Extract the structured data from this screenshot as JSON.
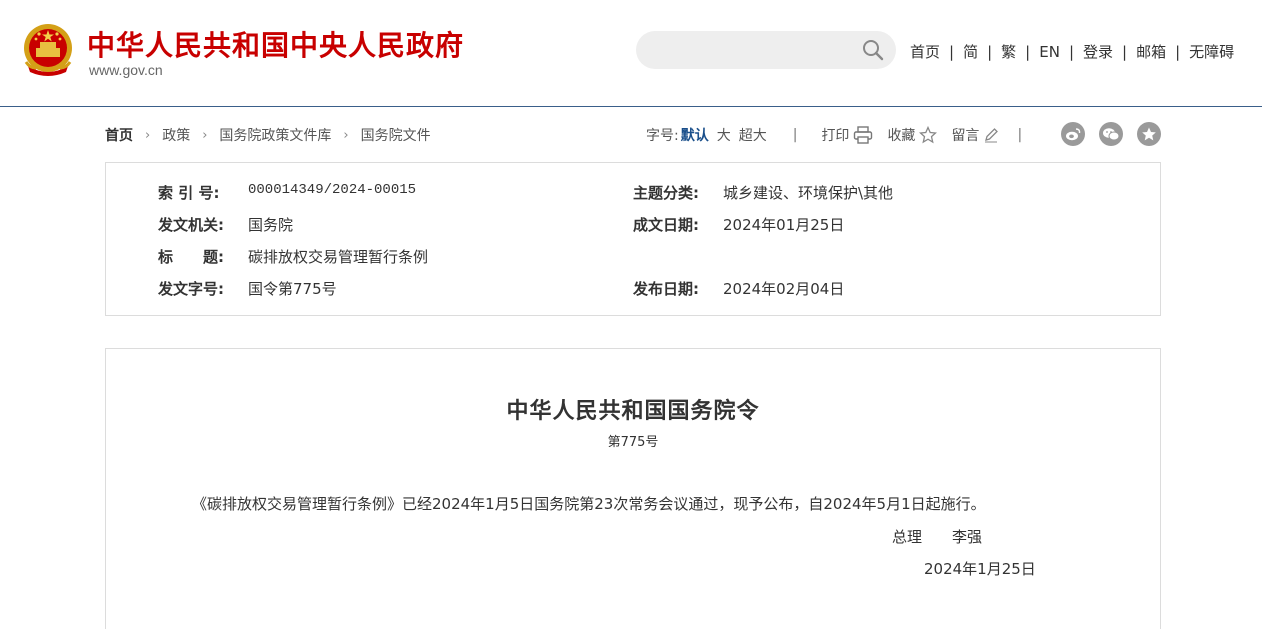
{
  "header": {
    "site_title": "中华人民共和国中央人民政府",
    "site_url": "www.gov.cn",
    "search_placeholder": "",
    "nav": [
      "首页",
      "简",
      "繁",
      "EN",
      "登录",
      "邮箱",
      "无障碍"
    ],
    "nav_separator": "|",
    "brand_color": "#c80000"
  },
  "breadcrumb": {
    "items": [
      "首页",
      "政策",
      "国务院政策文件库",
      "国务院文件"
    ],
    "chevron": "›"
  },
  "toolbar": {
    "font_size_label": "字号:",
    "font_sizes": [
      "默认",
      "大",
      "超大"
    ],
    "divider": "|",
    "print_label": "打印",
    "favorite_label": "收藏",
    "comment_label": "留言",
    "share_icons": [
      "weibo-icon",
      "wechat-icon",
      "star-share-icon"
    ]
  },
  "info": {
    "index_key": "索 引 号:",
    "index_value": "000014349/2024-00015",
    "topic_key": "主题分类:",
    "topic_value": "城乡建设、环境保护\\其他",
    "issuer_key": "发文机关:",
    "issuer_value": "国务院",
    "written_key": "成文日期:",
    "written_value": "2024年01月25日",
    "title_key": "标　　题:",
    "title_value": "碳排放权交易管理暂行条例",
    "docno_key": "发文字号:",
    "docno_value": "国令第775号",
    "publish_key": "发布日期:",
    "publish_value": "2024年02月04日"
  },
  "document": {
    "title": "中华人民共和国国务院令",
    "number": "第775号",
    "body": "《碳排放权交易管理暂行条例》已经2024年1月5日国务院第23次常务会议通过，现予公布，自2024年5月1日起施行。",
    "signer_title": "总理",
    "signer_name": "李强",
    "date": "2024年1月25日"
  }
}
